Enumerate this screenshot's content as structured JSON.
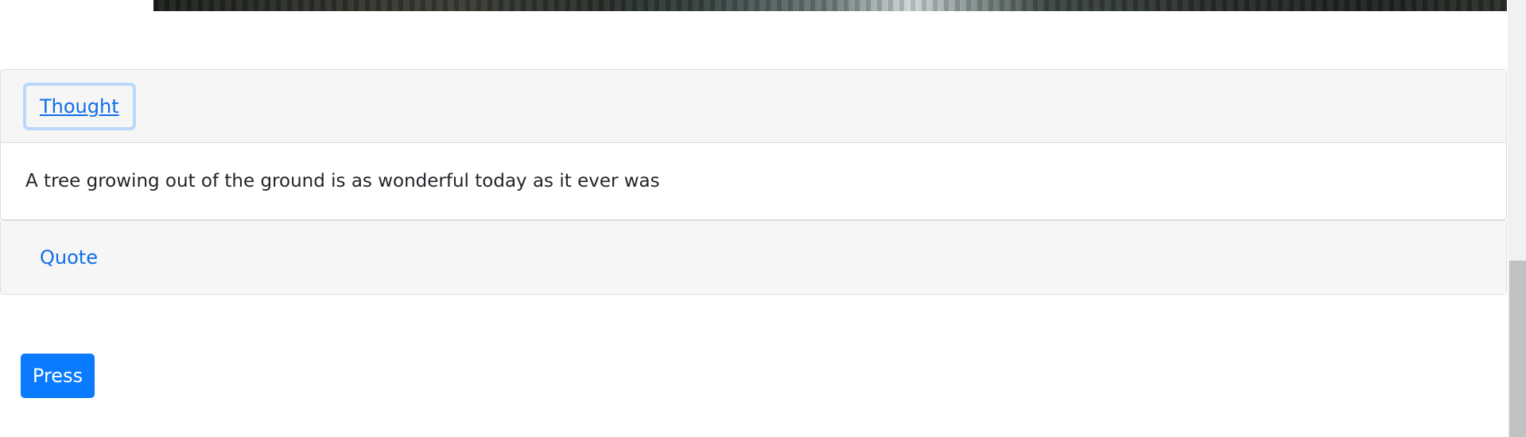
{
  "accordion": {
    "items": [
      {
        "header": "Thought",
        "body": "A tree growing out of the ground is as wonderful today as it ever was",
        "expanded": true,
        "focused": true
      },
      {
        "header": "Quote",
        "expanded": false,
        "focused": false
      }
    ]
  },
  "actions": {
    "press_label": "Press"
  },
  "colors": {
    "link": "#0f6ee8",
    "button": "#0a7bff",
    "header_bg": "#f6f6f6",
    "focus_ring": "#b9d8fb"
  }
}
